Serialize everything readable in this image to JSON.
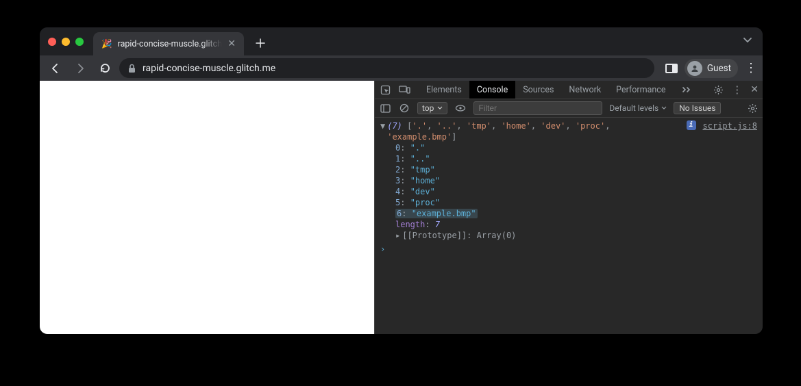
{
  "browser": {
    "tab_title": "rapid-concise-muscle.glitch.me",
    "new_tab_tooltip": "+",
    "url_display": "rapid-concise-muscle.glitch.me",
    "guest_label": "Guest"
  },
  "devtools": {
    "tabs": [
      "Elements",
      "Console",
      "Sources",
      "Network",
      "Performance"
    ],
    "active_tab": "Console",
    "context_label": "top",
    "filter_placeholder": "Filter",
    "levels_label": "Default levels",
    "issues_label": "No Issues",
    "source_link": "script.js:8"
  },
  "console": {
    "array_length_display": "(7)",
    "summary_items": [
      ".",
      "..",
      "tmp",
      "home",
      "dev",
      "proc",
      "example.bmp"
    ],
    "entries": [
      {
        "index": "0",
        "value": "\".\""
      },
      {
        "index": "1",
        "value": "\"..\""
      },
      {
        "index": "2",
        "value": "\"tmp\""
      },
      {
        "index": "3",
        "value": "\"home\""
      },
      {
        "index": "4",
        "value": "\"dev\""
      },
      {
        "index": "5",
        "value": "\"proc\""
      },
      {
        "index": "6",
        "value": "\"example.bmp\"",
        "highlighted": true
      }
    ],
    "length_key": "length",
    "length_value": "7",
    "prototype_label": "[[Prototype]]",
    "prototype_value": "Array(0)"
  }
}
